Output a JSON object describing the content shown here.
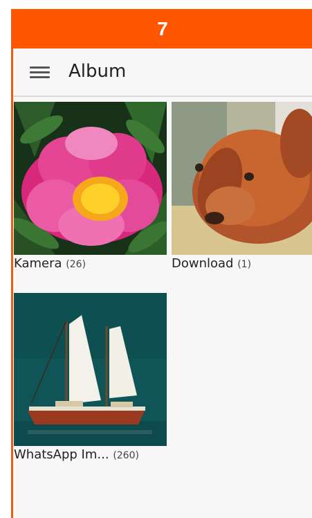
{
  "status": {
    "text": "7"
  },
  "header": {
    "title": "Album",
    "menu_icon": "hamburger-menu-icon"
  },
  "albums": [
    {
      "name": "Kamera",
      "count": "(26)",
      "thumb": "pink-peony-flower"
    },
    {
      "name": "Download",
      "count": "(1)",
      "thumb": "brown-puppy"
    },
    {
      "name": "WhatsApp Im...",
      "count": "(260)",
      "thumb": "sailboat-on-water"
    }
  ],
  "colors": {
    "accent": "#ff5700",
    "background": "#f7f7f7"
  }
}
